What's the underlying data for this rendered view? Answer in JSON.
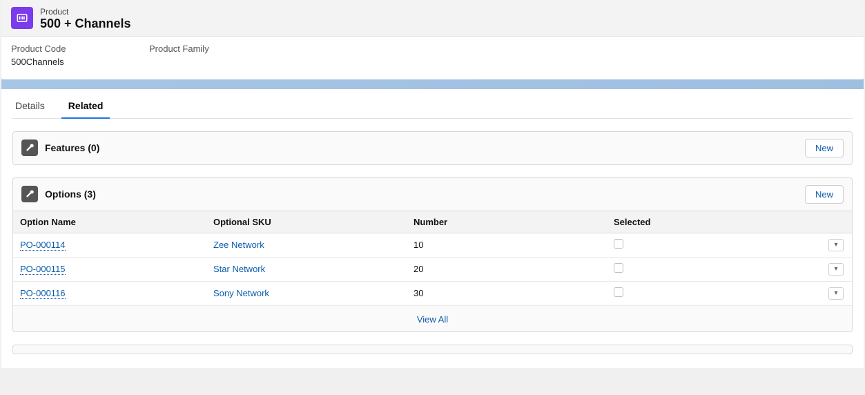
{
  "header": {
    "type_label": "Product",
    "title": "500 + Channels",
    "fields": [
      {
        "label": "Product Code",
        "value": "500Channels"
      },
      {
        "label": "Product Family",
        "value": ""
      }
    ]
  },
  "tabs": {
    "details": "Details",
    "related": "Related",
    "active": "related"
  },
  "buttons": {
    "new": "New",
    "view_all": "View All"
  },
  "related": {
    "features": {
      "title": "Features (0)"
    },
    "options": {
      "title": "Options (3)",
      "columns": {
        "name": "Option Name",
        "sku": "Optional SKU",
        "number": "Number",
        "selected": "Selected"
      },
      "rows": [
        {
          "name": "PO-000114",
          "sku": "Zee Network",
          "number": "10",
          "selected": false
        },
        {
          "name": "PO-000115",
          "sku": "Star Network",
          "number": "20",
          "selected": false
        },
        {
          "name": "PO-000116",
          "sku": "Sony Network",
          "number": "30",
          "selected": false
        }
      ]
    }
  }
}
